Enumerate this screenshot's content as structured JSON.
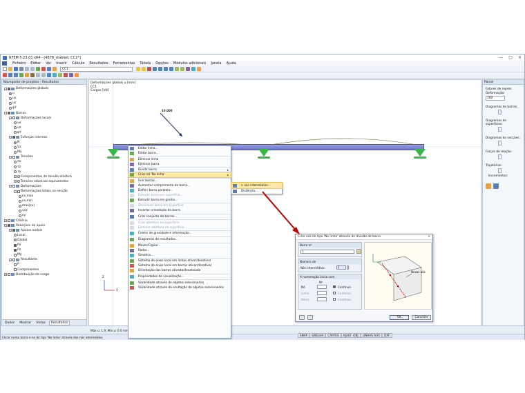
{
  "window": {
    "title": "RFEM 5.23.01 x64 - [4878_stabled, CC1*]",
    "controls": [
      "—",
      "□",
      "×"
    ]
  },
  "menu": [
    "Ficheiro",
    "Editar",
    "Ver",
    "Inserir",
    "Cálculo",
    "Resultados",
    "Ferramentas",
    "Tabela",
    "Opções",
    "Módulos adicionais",
    "Janela",
    "Ajuda"
  ],
  "toolbar": {
    "loadcase": "CC1"
  },
  "navigator": {
    "title": "Navegador de projetos - Resultados",
    "items": [
      {
        "label": "Deformações globais",
        "level": 0,
        "type": "check",
        "on": true,
        "exp": "−"
      },
      {
        "label": "u",
        "level": 1,
        "type": "radio",
        "on": true
      },
      {
        "label": "ux",
        "level": 1,
        "type": "radio",
        "on": false
      },
      {
        "label": "uz",
        "level": 1,
        "type": "radio",
        "on": false
      },
      {
        "label": "φY",
        "level": 1,
        "type": "radio",
        "on": false
      },
      {
        "label": "Barras",
        "level": 0,
        "type": "check",
        "on": true,
        "exp": "−"
      },
      {
        "label": "Deformações locais",
        "level": 1,
        "type": "check",
        "on": false,
        "exp": "−"
      },
      {
        "label": "ux",
        "level": 2,
        "type": "radio",
        "on": false
      },
      {
        "label": "uz",
        "level": 2,
        "type": "radio",
        "on": false
      },
      {
        "label": "φY",
        "level": 2,
        "type": "radio",
        "on": false
      },
      {
        "label": "Esforços internos",
        "level": 1,
        "type": "check",
        "on": true,
        "exp": "−"
      },
      {
        "label": "N",
        "level": 2,
        "type": "radio",
        "on": true
      },
      {
        "label": "Vz",
        "level": 2,
        "type": "radio",
        "on": false
      },
      {
        "label": "My",
        "level": 2,
        "type": "radio",
        "on": false
      },
      {
        "label": "Tensões",
        "level": 1,
        "type": "check",
        "on": false,
        "exp": "−"
      },
      {
        "label": "σx",
        "level": 2,
        "type": "radio",
        "on": false
      },
      {
        "label": "τz",
        "level": 2,
        "type": "radio",
        "on": false
      },
      {
        "label": "τy",
        "level": 2,
        "type": "radio",
        "on": false
      },
      {
        "label": "Componentes de tensão elástica",
        "level": 2,
        "type": "radio",
        "on": false,
        "exp": "+"
      },
      {
        "label": "Tensões elásticas equivalentes",
        "level": 2,
        "type": "radio",
        "on": false,
        "exp": "+"
      },
      {
        "label": "Deformações",
        "level": 1,
        "type": "check",
        "on": false,
        "exp": "−"
      },
      {
        "label": "Deformações totais na secção",
        "level": 2,
        "type": "check",
        "on": false,
        "exp": "−"
      },
      {
        "label": "εx,max",
        "level": 3,
        "type": "radio",
        "on": false
      },
      {
        "label": "εx,min",
        "level": 3,
        "type": "radio",
        "on": false
      },
      {
        "label": "max|εx|",
        "level": 3,
        "type": "radio",
        "on": false
      },
      {
        "label": "γxz",
        "level": 3,
        "type": "radio",
        "on": false
      },
      {
        "label": "κy",
        "level": 3,
        "type": "radio",
        "on": false
      },
      {
        "label": "Critério",
        "level": 0,
        "type": "check",
        "on": false,
        "exp": "+"
      },
      {
        "label": "Reacções do apoio",
        "level": 0,
        "type": "check",
        "on": true,
        "exp": "−"
      },
      {
        "label": "Apoios nodais",
        "level": 1,
        "type": "check",
        "on": true,
        "exp": "−"
      },
      {
        "label": "Local",
        "level": 2,
        "type": "radio",
        "on": false
      },
      {
        "label": "Global",
        "level": 2,
        "type": "radio",
        "on": true
      },
      {
        "label": "Px",
        "level": 2,
        "type": "check",
        "on": true
      },
      {
        "label": "Pz",
        "level": 2,
        "type": "check",
        "on": true
      },
      {
        "label": "My",
        "level": 2,
        "type": "check",
        "on": false
      },
      {
        "label": "Resultante",
        "level": 1,
        "type": "check",
        "on": false,
        "exp": "−"
      },
      {
        "label": "P",
        "level": 2,
        "type": "check",
        "on": false
      },
      {
        "label": "Componentes",
        "level": 2,
        "type": "check",
        "on": false
      },
      {
        "label": "Distribuição de carga",
        "level": 0,
        "type": "check",
        "on": false,
        "exp": "+"
      }
    ],
    "tabs": [
      "Dados",
      "Mostrar",
      "Vistas",
      "Resultados"
    ]
  },
  "view": {
    "info": [
      "Deformações globais u [mm]",
      "CC1",
      "Cargas [kN]"
    ],
    "load_value": "10.000",
    "scale": "Máx u: 1.9, Mín u: 0.0 mm",
    "axis_x": "X",
    "axis_z": "Z"
  },
  "context_menu": [
    {
      "label": "Editar linha...",
      "disabled": false
    },
    {
      "label": "Editar barra...",
      "disabled": false
    },
    {
      "sep": true
    },
    {
      "label": "Eliminar linha",
      "disabled": false
    },
    {
      "label": "Eliminar barra",
      "disabled": false
    },
    {
      "sep": true
    },
    {
      "label": "Dividir barra",
      "disabled": false,
      "sub": true
    },
    {
      "label": "Criar nó 'Na linha'",
      "disabled": false,
      "sub": true,
      "hl": true
    },
    {
      "sep": true
    },
    {
      "label": "Unir barras...",
      "disabled": false
    },
    {
      "label": "Aumentar comprimento de barra...",
      "disabled": false
    },
    {
      "label": "Definir barra paralela...",
      "disabled": false
    },
    {
      "label": "Extrudir barra em superfície...",
      "disabled": true
    },
    {
      "label": "Extrudir barra em grelha...",
      "disabled": false
    },
    {
      "sep": true
    },
    {
      "label": "Decompor barra em superfície",
      "disabled": true
    },
    {
      "label": "Inverter orientação da barra",
      "disabled": false
    },
    {
      "sep": true
    },
    {
      "label": "Criar conjunto de barras...",
      "disabled": false
    },
    {
      "sep": true
    },
    {
      "label": "Criar abertura na superfície",
      "disabled": true
    },
    {
      "label": "Eliminar abertura na superfície",
      "disabled": true
    },
    {
      "sep": true
    },
    {
      "label": "Centro de gravidade e informação...",
      "disabled": false
    },
    {
      "sep": true
    },
    {
      "label": "Diagramas de resultados...",
      "disabled": false
    },
    {
      "sep": true
    },
    {
      "label": "Mover/Copiar...",
      "disabled": false
    },
    {
      "label": "Rodar...",
      "disabled": false
    },
    {
      "label": "Simetria...",
      "disabled": false
    },
    {
      "sep": true
    },
    {
      "label": "Sistema de eixos local em linhas ativar/desativar",
      "disabled": false
    },
    {
      "label": "Sistema de eixos local em barras ativar/desativar",
      "disabled": false
    },
    {
      "label": "Orientação das barras ativada/desativada",
      "disabled": false
    },
    {
      "sep": true
    },
    {
      "label": "Propriedades de visualização...",
      "disabled": false
    },
    {
      "sep": true
    },
    {
      "label": "Visibilidade através de objetos selecionados",
      "disabled": false
    },
    {
      "label": "Visibilidade através da ocultação de objetos selecionados",
      "disabled": false
    }
  ],
  "submenu": [
    {
      "label": "n nós intermédios...",
      "hl": true
    },
    {
      "label": "Distância...",
      "hl": false
    }
  ],
  "right_panel": {
    "title": "Painel",
    "factors_label": "Fatores de repres.",
    "deformation_label": "Deformação:",
    "deformation_value": "100",
    "member_diagrams": "Diagramas de barras:",
    "surface_diagrams": "Diagramas de superfícies:",
    "section_diagrams": "Diagramas de secções:",
    "reaction_forces": "Forças de reação:",
    "trajectories": "Trajetórias:",
    "increments": "Incrementos:"
  },
  "dialog": {
    "title": "Criar nós do tipo 'Na linha' através de divisão de barra",
    "close": "×",
    "member_no_title": "Barra nº",
    "member_no": "1",
    "node_count_title": "Número de",
    "intermediate_label": "Nós intermédios:",
    "intermediate_value": "1",
    "numbering_title": "A numeração inicia com",
    "col_header": "Nº",
    "rows": [
      {
        "label": "Nó",
        "value": "",
        "cont": "Contínuo",
        "on": true
      },
      {
        "label": "Linha",
        "value": "",
        "cont": "Contínuo",
        "on": false
      },
      {
        "label": "Barra",
        "value": "",
        "cont": "Contínuo",
        "on": false
      }
    ],
    "diagram_label": "Novos nós",
    "ok": "OK",
    "cancel": "Cancelar"
  },
  "status": {
    "text": "Clicar numa barra e no do tipo 'Na linha' através dos nós intermédios",
    "tabs": [
      "SNAP",
      "GRELHA",
      "CARTES",
      "AJUST. OBJ",
      "LINHAS AUX",
      "DXF"
    ]
  }
}
